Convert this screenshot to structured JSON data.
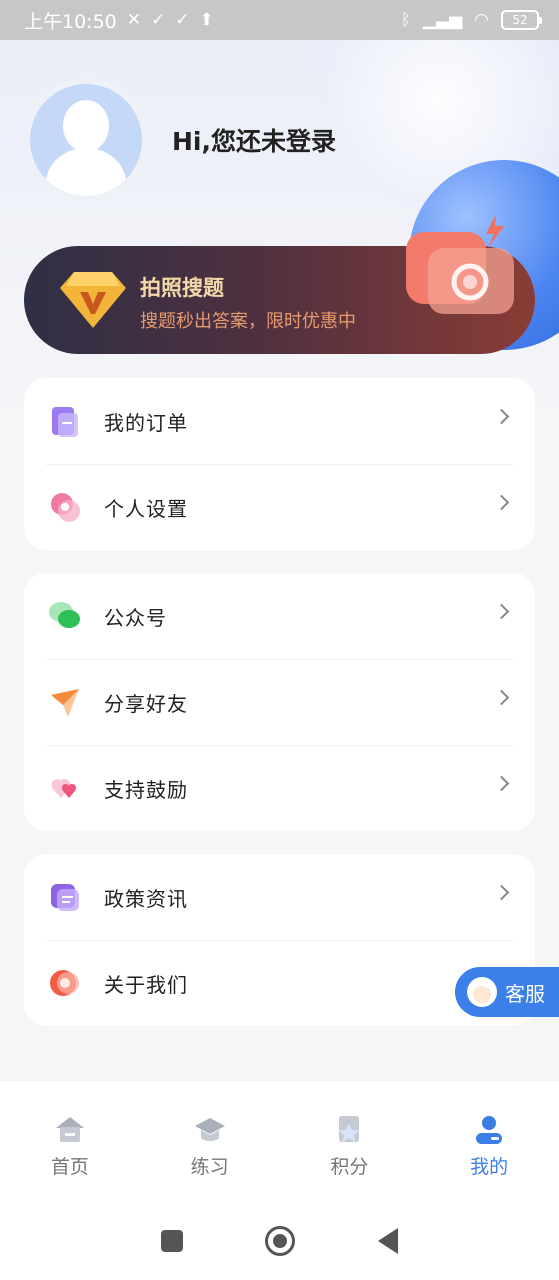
{
  "status_bar": {
    "time": "上午10:50",
    "battery": "52"
  },
  "profile": {
    "greeting": "Hi,您还未登录"
  },
  "promo": {
    "title": "拍照搜题",
    "subtitle": "搜题秒出答案，限时优惠中"
  },
  "menu_groups": [
    {
      "items": [
        {
          "label": "我的订单",
          "icon": "order-icon"
        },
        {
          "label": "个人设置",
          "icon": "settings-icon"
        }
      ]
    },
    {
      "items": [
        {
          "label": "公众号",
          "icon": "wechat-icon"
        },
        {
          "label": "分享好友",
          "icon": "share-icon"
        },
        {
          "label": "支持鼓励",
          "icon": "heart-icon"
        }
      ]
    },
    {
      "items": [
        {
          "label": "政策资讯",
          "icon": "news-icon"
        },
        {
          "label": "关于我们",
          "icon": "about-icon"
        }
      ]
    }
  ],
  "customer_service": {
    "label": "客服"
  },
  "tabbar": {
    "tabs": [
      {
        "label": "首页",
        "icon": "home-icon"
      },
      {
        "label": "练习",
        "icon": "graduation-cap-icon"
      },
      {
        "label": "积分",
        "icon": "points-star-icon"
      },
      {
        "label": "我的",
        "icon": "user-icon",
        "active": true
      }
    ]
  },
  "colors": {
    "accent": "#3d7ee4",
    "promo_title": "#f3d9a9",
    "promo_sub": "#e69a6f"
  }
}
